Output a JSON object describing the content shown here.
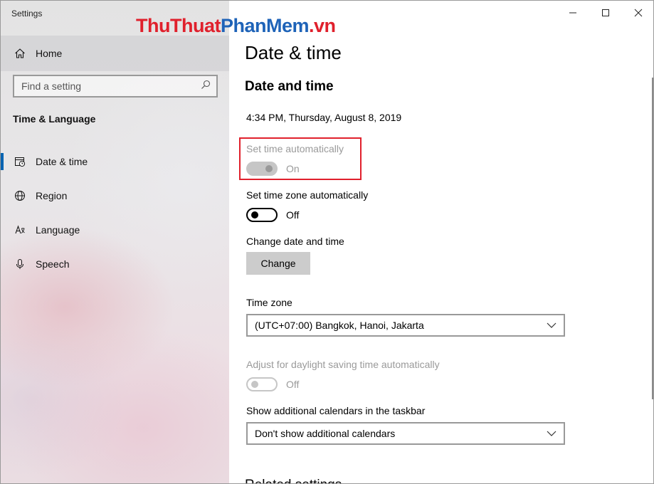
{
  "window": {
    "title": "Settings",
    "watermark_part1": "ThuThuat",
    "watermark_part2": "PhanMem",
    "watermark_part3": ".vn"
  },
  "sidebar": {
    "home_label": "Home",
    "search_placeholder": "Find a setting",
    "section_label": "Time & Language",
    "items": [
      {
        "label": "Date & time",
        "icon": "calendar-clock-icon",
        "active": true
      },
      {
        "label": "Region",
        "icon": "globe-icon",
        "active": false
      },
      {
        "label": "Language",
        "icon": "language-icon",
        "active": false
      },
      {
        "label": "Speech",
        "icon": "microphone-icon",
        "active": false
      }
    ]
  },
  "main": {
    "page_title": "Date & time",
    "section_title": "Date and time",
    "current_time": "4:34 PM, Thursday, August 8, 2019",
    "set_time_auto": {
      "label": "Set time automatically",
      "state": "On"
    },
    "set_timezone_auto": {
      "label": "Set time zone automatically",
      "state": "Off"
    },
    "change_date_time": {
      "label": "Change date and time",
      "button": "Change"
    },
    "time_zone": {
      "label": "Time zone",
      "value": "(UTC+07:00) Bangkok, Hanoi, Jakarta"
    },
    "daylight": {
      "label": "Adjust for daylight saving time automatically",
      "state": "Off"
    },
    "calendars": {
      "label": "Show additional calendars in the taskbar",
      "value": "Don't show additional calendars"
    },
    "related_title": "Related settings"
  },
  "colors": {
    "accent": "#0063b1",
    "highlight_box": "#e0202c",
    "watermark_red": "#e0202c",
    "watermark_blue": "#1e63b8"
  }
}
